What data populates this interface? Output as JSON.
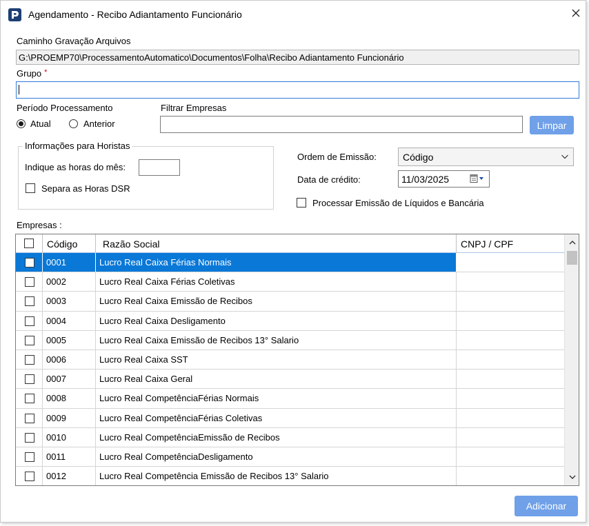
{
  "window": {
    "title": "Agendamento - Recibo Adiantamento Funcionário"
  },
  "fields": {
    "caminho_label": "Caminho Gravação Arquivos",
    "caminho_value": "G:\\PROEMP70\\ProcessamentoAutomatico\\Documentos\\Folha\\Recibo Adiantamento Funcionário",
    "grupo_label": "Grupo",
    "grupo_required": "*",
    "grupo_value": ""
  },
  "periodo": {
    "label": "Período Processamento",
    "option_atual": "Atual",
    "option_anterior": "Anterior",
    "selected": "Atual"
  },
  "filtro": {
    "label": "Filtrar Empresas",
    "value": "",
    "limpar_label": "Limpar"
  },
  "horistas": {
    "title": "Informações para Horistas",
    "horas_label": "Indique as horas do mês:",
    "horas_value": "",
    "dsr_label": "Separa as Horas DSR",
    "dsr_checked": false
  },
  "ordem": {
    "label": "Ordem de Emissão:",
    "value": "Código"
  },
  "credito": {
    "label": "Data de crédito:",
    "value": "11/03/2025"
  },
  "processar": {
    "label": "Processar Emissão de Líquidos e Bancária",
    "checked": false
  },
  "empresas": {
    "label": "Empresas :",
    "columns": {
      "codigo": "Código",
      "razao": "Razão Social",
      "cnpj": "CNPJ / CPF"
    },
    "rows": [
      {
        "codigo": "0001",
        "razao": "Lucro Real Caixa Férias Normais",
        "cnpj": "",
        "selected": true
      },
      {
        "codigo": "0002",
        "razao": "Lucro Real Caixa Férias Coletivas",
        "cnpj": ""
      },
      {
        "codigo": "0003",
        "razao": "Lucro Real Caixa Emissão de Recibos",
        "cnpj": ""
      },
      {
        "codigo": "0004",
        "razao": "Lucro Real Caixa Desligamento",
        "cnpj": ""
      },
      {
        "codigo": "0005",
        "razao": "Lucro Real Caixa Emissão de Recibos 13° Salario",
        "cnpj": ""
      },
      {
        "codigo": "0006",
        "razao": "Lucro Real Caixa SST",
        "cnpj": ""
      },
      {
        "codigo": "0007",
        "razao": "Lucro Real Caixa Geral",
        "cnpj": ""
      },
      {
        "codigo": "0008",
        "razao": "Lucro Real CompetênciaFérias Normais",
        "cnpj": ""
      },
      {
        "codigo": "0009",
        "razao": "Lucro Real CompetênciaFérias Coletivas",
        "cnpj": ""
      },
      {
        "codigo": "0010",
        "razao": "Lucro Real CompetênciaEmissão de Recibos",
        "cnpj": ""
      },
      {
        "codigo": "0011",
        "razao": "Lucro Real CompetênciaDesligamento",
        "cnpj": ""
      },
      {
        "codigo": "0012",
        "razao": "Lucro Real Competência Emissão de Recibos 13° Salario",
        "cnpj": ""
      }
    ]
  },
  "footer": {
    "adicionar_label": "Adicionar"
  },
  "colors": {
    "selection": "#0a78d7",
    "button": "#6fa0e8",
    "focus_border": "#2f7bd8",
    "required": "#d0021b"
  }
}
